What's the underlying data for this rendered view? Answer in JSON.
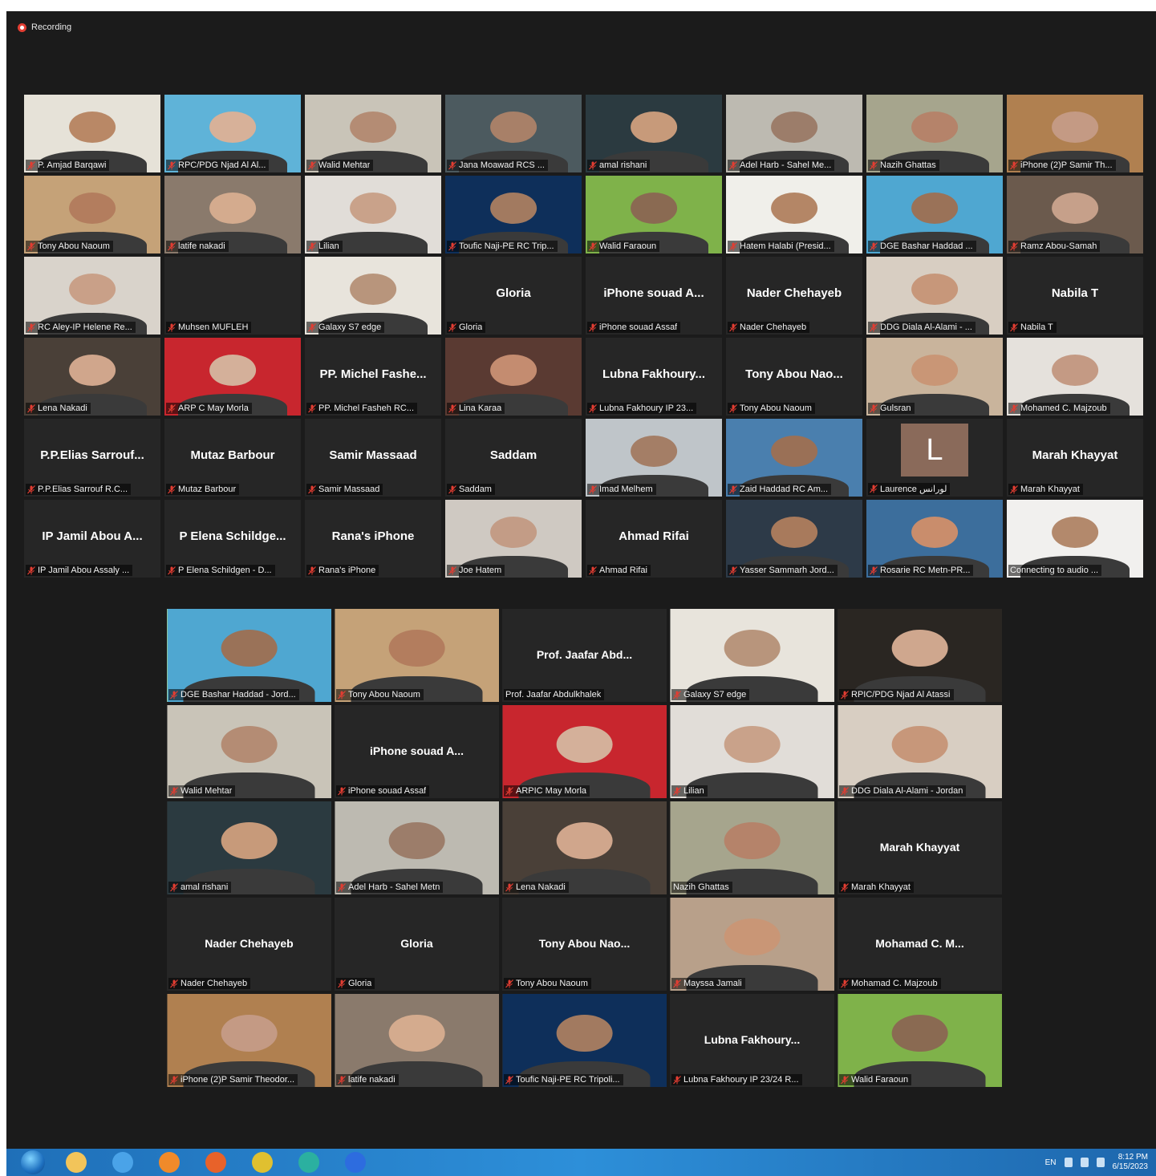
{
  "recording": {
    "label": "Recording"
  },
  "gallery_top": [
    {
      "label": "P. Amjad Barqawi",
      "video": true,
      "bg": "#e6e2d8",
      "skin": "#b98866"
    },
    {
      "label": "RPC/PDG Njad Al Al...",
      "video": true,
      "bg": "#5fb3d8",
      "skin": "#d7b199"
    },
    {
      "label": "Walid Mehtar",
      "video": true,
      "bg": "#c9c4b8",
      "skin": "#b48c74"
    },
    {
      "label": "Jana Moawad RCS ...",
      "video": true,
      "bg": "#4c5a5f",
      "skin": "#a88068"
    },
    {
      "label": "amal rishani",
      "video": true,
      "bg": "#2b3a40",
      "skin": "#c79a7a"
    },
    {
      "label": "Adel Harb - Sahel Me...",
      "video": true,
      "bg": "#bdbab1",
      "skin": "#9c7d6a"
    },
    {
      "label": "Nazih Ghattas",
      "video": true,
      "bg": "#a6a58d",
      "skin": "#b5836a"
    },
    {
      "label": "iPhone (2)P Samir Th...",
      "video": true,
      "bg": "#b08050",
      "skin": "#c49a84"
    },
    {
      "label": "Tony Abou Naoum",
      "video": true,
      "bg": "#c5a278",
      "skin": "#b37d5e"
    },
    {
      "label": "latife nakadi",
      "video": true,
      "bg": "#8a7a6c",
      "skin": "#d4ab8e"
    },
    {
      "label": "Lilian",
      "video": true,
      "bg": "#e1ddd8",
      "skin": "#c9a28a"
    },
    {
      "label": "Toufic Naji-PE RC Trip...",
      "video": true,
      "bg": "#0e2f5a",
      "skin": "#a27a60"
    },
    {
      "label": "Walid Faraoun",
      "video": true,
      "bg": "#7fb24a",
      "skin": "#8a6a52"
    },
    {
      "label": "Hatem Halabi (Presid...",
      "video": true,
      "bg": "#f0efea",
      "skin": "#b48666"
    },
    {
      "label": "DGE Bashar Haddad ...",
      "video": true,
      "bg": "#4fa7d1",
      "skin": "#9a7258"
    },
    {
      "label": "Ramz Abou-Samah",
      "video": true,
      "bg": "#6b5a4d",
      "skin": "#c6a08a"
    },
    {
      "label": "RC Aley-IP Helene Re...",
      "video": true,
      "bg": "#d9d3cb",
      "skin": "#c9a088"
    },
    {
      "label": "Muhsen MUFLEH",
      "video": false,
      "name": ""
    },
    {
      "label": "Galaxy S7 edge",
      "video": true,
      "bg": "#e8e4dc",
      "skin": "#b8957c"
    },
    {
      "label": "Gloria",
      "video": false,
      "name": "Gloria"
    },
    {
      "label": "iPhone souad Assaf",
      "video": false,
      "name": "iPhone souad A..."
    },
    {
      "label": "Nader Chehayeb",
      "video": false,
      "name": "Nader Chehayeb"
    },
    {
      "label": "DDG Diala Al-Alami - ...",
      "video": true,
      "bg": "#d8cec2",
      "skin": "#c7977a"
    },
    {
      "label": "Nabila T",
      "video": false,
      "name": "Nabila T"
    },
    {
      "label": "Lena Nakadi",
      "video": true,
      "bg": "#4a4038",
      "skin": "#d0a68c"
    },
    {
      "label": "ARP C May Morla",
      "video": true,
      "bg": "#c8262e",
      "skin": "#d4b09a"
    },
    {
      "label": "PP. Michel Fasheh RC...",
      "video": false,
      "name": "PP. Michel Fashe..."
    },
    {
      "label": "Lina Karaa",
      "video": true,
      "bg": "#5a3a32",
      "skin": "#c48c70"
    },
    {
      "label": "Lubna Fakhoury IP 23...",
      "video": false,
      "name": "Lubna Fakhoury..."
    },
    {
      "label": "Tony Abou Naoum",
      "video": false,
      "name": "Tony Abou Nao..."
    },
    {
      "label": "Gulsran",
      "video": true,
      "bg": "#c9b49c",
      "skin": "#c99676"
    },
    {
      "label": "Mohamed C. Majzoub",
      "video": true,
      "bg": "#e5e1dc",
      "skin": "#c49a84"
    },
    {
      "label": "P.P.Elias Sarrouf R.C...",
      "video": false,
      "name": "P.P.Elias  Sarrouf..."
    },
    {
      "label": "Mutaz Barbour",
      "video": false,
      "name": "Mutaz Barbour"
    },
    {
      "label": "Samir Massaad",
      "video": false,
      "name": "Samir Massaad"
    },
    {
      "label": "Saddam",
      "video": false,
      "name": "Saddam"
    },
    {
      "label": "Imad Melhem",
      "video": true,
      "bg": "#bfc5c9",
      "skin": "#a47e66"
    },
    {
      "label": "Zaid Haddad RC Am...",
      "video": true,
      "bg": "#4a7fae",
      "skin": "#9a7056"
    },
    {
      "label": "Laurence       لورانس",
      "video": false,
      "name": "",
      "letter": "L"
    },
    {
      "label": "Marah Khayyat",
      "video": false,
      "name": "Marah Khayyat"
    },
    {
      "label": "IP Jamil Abou Assaly ...",
      "video": false,
      "name": "IP Jamil Abou A..."
    },
    {
      "label": "P Elena Schildgen - D...",
      "video": false,
      "name": "P  Elena  Schildge..."
    },
    {
      "label": "Rana's iPhone",
      "video": false,
      "name": "Rana's iPhone"
    },
    {
      "label": "Joe Hatem",
      "video": true,
      "bg": "#cfc9c2",
      "skin": "#c39c86"
    },
    {
      "label": "Ahmad Rifai",
      "video": false,
      "name": "Ahmad Rifai"
    },
    {
      "label": "Yasser Sammarh Jord...",
      "video": true,
      "bg": "#2d3a48",
      "skin": "#a87a5c"
    },
    {
      "label": "Rosarie RC Metn-PR...",
      "video": true,
      "bg": "#3c6e9c",
      "skin": "#c98d6c"
    },
    {
      "label": "Connecting to audio ...",
      "video": true,
      "bg": "#f1f0ee",
      "skin": "#b3896c",
      "nomic": true
    }
  ],
  "gallery_bottom": [
    {
      "label": "DGE Bashar Haddad - Jord...",
      "video": true,
      "bg": "#4fa7d1",
      "skin": "#9a7258",
      "active": true
    },
    {
      "label": "Tony Abou Naoum",
      "video": true,
      "bg": "#c5a278",
      "skin": "#b37d5e"
    },
    {
      "label": "Prof. Jaafar Abdulkhalek",
      "video": false,
      "name": "Prof.  Jaafar  Abd...",
      "nomic": true
    },
    {
      "label": "Galaxy S7 edge",
      "video": true,
      "bg": "#e8e4dc",
      "skin": "#b8957c"
    },
    {
      "label": "RPIC/PDG Njad Al Atassi",
      "video": true,
      "bg": "#2a2622",
      "skin": "#cfa78e"
    },
    {
      "label": "Walid Mehtar",
      "video": true,
      "bg": "#c9c4b8",
      "skin": "#b48c74"
    },
    {
      "label": "iPhone souad Assaf",
      "video": false,
      "name": "iPhone  souad  A..."
    },
    {
      "label": "ARPIC May Morla",
      "video": true,
      "bg": "#c8262e",
      "skin": "#d4b09a"
    },
    {
      "label": "Lilian",
      "video": true,
      "bg": "#e1ddd8",
      "skin": "#c9a28a"
    },
    {
      "label": "DDG Diala Al-Alami - Jordan",
      "video": true,
      "bg": "#d8cec2",
      "skin": "#c7977a"
    },
    {
      "label": "amal rishani",
      "video": true,
      "bg": "#2b3a40",
      "skin": "#c79a7a"
    },
    {
      "label": "Adel Harb - Sahel Metn",
      "video": true,
      "bg": "#bdbab1",
      "skin": "#9c7d6a"
    },
    {
      "label": "Lena Nakadi",
      "video": true,
      "bg": "#4a4038",
      "skin": "#d0a68c"
    },
    {
      "label": "Nazih Ghattas",
      "video": true,
      "bg": "#a6a58d",
      "skin": "#b5836a",
      "nomic": true
    },
    {
      "label": "Marah Khayyat",
      "video": false,
      "name": "Marah  Khayyat"
    },
    {
      "label": "Nader Chehayeb",
      "video": false,
      "name": "Nader  Chehayeb"
    },
    {
      "label": "Gloria",
      "video": false,
      "name": "Gloria"
    },
    {
      "label": "Tony Abou Naoum",
      "video": false,
      "name": "Tony  Abou  Nao..."
    },
    {
      "label": "Mayssa Jamali",
      "video": true,
      "bg": "#b8a08a",
      "skin": "#c99676"
    },
    {
      "label": "Mohamad C. Majzoub",
      "video": false,
      "name": "Mohamad  C.  M..."
    },
    {
      "label": "iPhone (2)P Samir Theodor...",
      "video": true,
      "bg": "#b08050",
      "skin": "#c49a84"
    },
    {
      "label": "latife nakadi",
      "video": true,
      "bg": "#8a7a6c",
      "skin": "#d4ab8e"
    },
    {
      "label": "Toufic Naji-PE RC Tripoli...",
      "video": true,
      "bg": "#0e2f5a",
      "skin": "#a27a60"
    },
    {
      "label": "Lubna Fakhoury IP 23/24 R...",
      "video": false,
      "name": "Lubna  Fakhoury..."
    },
    {
      "label": "Walid Faraoun",
      "video": true,
      "bg": "#7fb24a",
      "skin": "#8a6a52"
    }
  ],
  "taskbar": {
    "apps": [
      {
        "icon": "file-explorer-icon",
        "color": "#f2c45a"
      },
      {
        "icon": "internet-explorer-icon",
        "color": "#4aa3e8"
      },
      {
        "icon": "media-player-icon",
        "color": "#f08a2a"
      },
      {
        "icon": "firefox-icon",
        "color": "#e8622a"
      },
      {
        "icon": "chrome-icon",
        "color": "#e0c030"
      },
      {
        "icon": "edge-icon",
        "color": "#2bb0a0"
      },
      {
        "icon": "zoom-icon",
        "color": "#2d6cdf"
      }
    ],
    "language": "EN",
    "time": "8:12 PM",
    "date": "6/15/2023"
  }
}
